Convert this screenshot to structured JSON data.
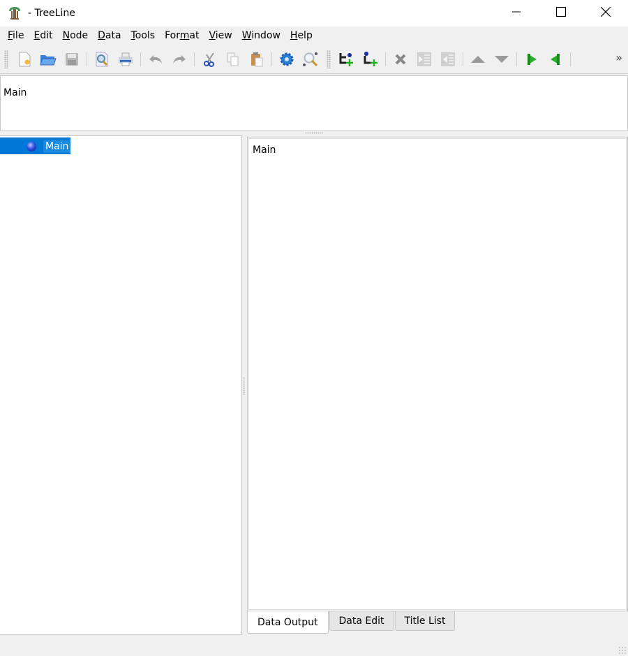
{
  "window": {
    "title": "- TreeLine",
    "app_icon": "treeline-logo-icon",
    "controls": {
      "minimize": "minimize-icon",
      "maximize": "maximize-icon",
      "close": "close-icon"
    }
  },
  "menu": {
    "items": [
      {
        "label": "File",
        "mnemonic": "F"
      },
      {
        "label": "Edit",
        "mnemonic": "E"
      },
      {
        "label": "Node",
        "mnemonic": "N"
      },
      {
        "label": "Data",
        "mnemonic": "D"
      },
      {
        "label": "Tools",
        "mnemonic": "T"
      },
      {
        "label": "Format",
        "mnemonic": "m"
      },
      {
        "label": "View",
        "mnemonic": "V"
      },
      {
        "label": "Window",
        "mnemonic": "W"
      },
      {
        "label": "Help",
        "mnemonic": "H"
      }
    ]
  },
  "toolbar": {
    "groups": [
      [
        "new-file-icon",
        "open-file-icon",
        "save-icon"
      ],
      [
        "print-preview-icon",
        "print-icon"
      ],
      [
        "undo-icon",
        "redo-icon"
      ],
      [
        "cut-icon",
        "copy-icon",
        "paste-icon"
      ],
      [
        "settings-gear-icon",
        "find-icon"
      ],
      [
        "insert-sibling-icon",
        "insert-child-icon"
      ],
      [
        "delete-icon",
        "indent-icon",
        "unindent-icon"
      ],
      [
        "move-up-icon",
        "move-down-icon"
      ],
      [
        "next-icon",
        "previous-icon"
      ]
    ],
    "overflow_label": "»"
  },
  "breadcrumb_pane": {
    "text": "Main"
  },
  "tree": {
    "nodes": [
      {
        "label": "Main",
        "selected": true
      }
    ]
  },
  "output_pane": {
    "text": "Main"
  },
  "tabs": [
    {
      "label": "Data Output",
      "active": true
    },
    {
      "label": "Data Edit",
      "active": false
    },
    {
      "label": "Title List",
      "active": false
    }
  ],
  "colors": {
    "selection": "#0078d7",
    "chrome": "#f0f0f0"
  }
}
